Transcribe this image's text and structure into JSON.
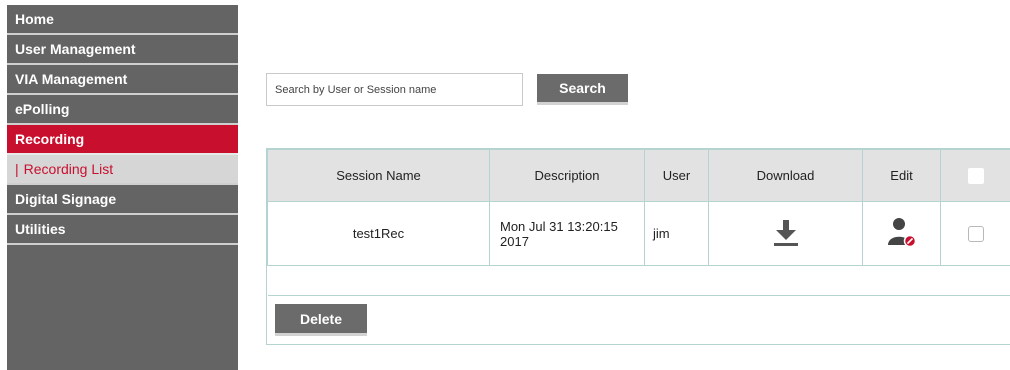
{
  "sidebar": {
    "items": [
      {
        "label": "Home"
      },
      {
        "label": "User Management"
      },
      {
        "label": "VIA Management"
      },
      {
        "label": "ePolling"
      },
      {
        "label": "Recording"
      },
      {
        "label": "Recording List",
        "prefix": "|"
      },
      {
        "label": "Digital Signage"
      },
      {
        "label": "Utilities"
      }
    ],
    "active_index": 4,
    "active_sub_index": 5
  },
  "search": {
    "placeholder": "Search by User or Session name",
    "value": "",
    "button_label": "Search"
  },
  "table": {
    "headers": [
      "Session Name",
      "Description",
      "User",
      "Download",
      "Edit"
    ],
    "rows": [
      {
        "session_name": "test1Rec",
        "description": "Mon Jul 31 13:20:15 2017",
        "user": "jim",
        "download_icon": "download-icon",
        "edit_icon": "user-edit-icon"
      }
    ]
  },
  "actions": {
    "delete_label": "Delete"
  },
  "colors": {
    "sidebar_bg": "#646464",
    "accent_red": "#c8102e",
    "button_gray": "#6b6b6b",
    "table_border": "#b5d3d0",
    "header_bg": "#e2e2e2"
  }
}
